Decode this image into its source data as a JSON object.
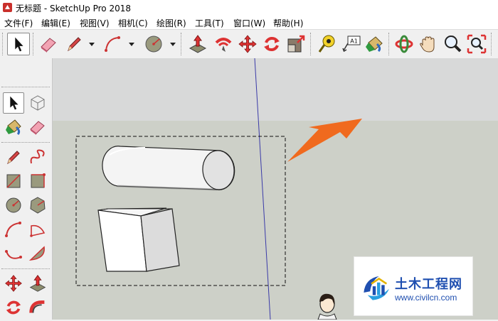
{
  "window": {
    "title": "无标题 - SketchUp Pro 2018"
  },
  "menu": [
    "文件(F)",
    "编辑(E)",
    "视图(V)",
    "相机(C)",
    "绘图(R)",
    "工具(T)",
    "窗口(W)",
    "帮助(H)"
  ],
  "toolbar": {
    "tools": [
      "select-tool",
      "eraser-tool",
      "pencil-tool",
      "arc-tool",
      "circle-tool",
      "push-pull-tool",
      "follow-me-tool",
      "move-tool",
      "rotate-tool",
      "scale-tool",
      "tape-measure-tool",
      "text-tool",
      "paint-bucket-tool",
      "orbit-tool",
      "pan-tool",
      "zoom-tool",
      "zoom-extents-tool"
    ],
    "text_tool_label": "A1",
    "selected_tool": "select-tool"
  },
  "left_toolbar": {
    "tools": [
      "select-tool",
      "make-component-tool",
      "paint-bucket-tool",
      "eraser-tool",
      "pencil-tool",
      "freehand-tool",
      "rectangle-tool",
      "rotated-rectangle-tool",
      "circle-tool",
      "polygon-tool",
      "arc-tool",
      "pie-tool",
      "2-point-arc-tool",
      "3-point-arc-tool",
      "move-tool",
      "push-pull-tool",
      "rotate-tool",
      "follow-me-tool"
    ],
    "selected_tool": "select-tool"
  },
  "scene": {
    "objects": [
      "cylinder",
      "cube"
    ],
    "selection": "selection-box",
    "annotation": "orange-arrow",
    "colors": {
      "sky": "#d8d9d9",
      "ground": "#cdd0c8",
      "blue_axis": "#3a3aa8",
      "arrow": "#f06a1e"
    }
  },
  "watermark": {
    "title": "土木工程网",
    "url": "www.civilcn.com"
  }
}
